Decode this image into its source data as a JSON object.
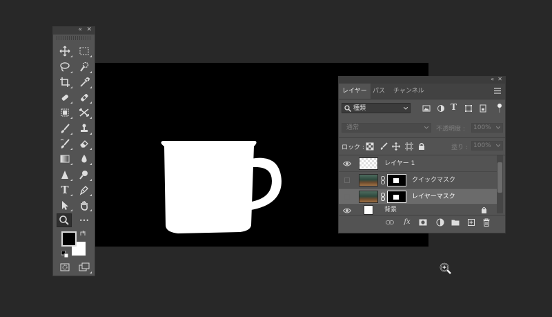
{
  "tools_panel": {
    "collapse_glyph": "«",
    "close_glyph": "✕",
    "tools": [
      {
        "icon": "move-icon"
      },
      {
        "icon": "marquee-icon"
      },
      {
        "icon": "lasso-icon"
      },
      {
        "icon": "quick-select-icon"
      },
      {
        "icon": "crop-icon"
      },
      {
        "icon": "eyedropper-icon"
      },
      {
        "icon": "healing-brush-icon"
      },
      {
        "icon": "bandage-icon"
      },
      {
        "icon": "clone-stamp-icon"
      },
      {
        "icon": "content-aware-move-icon"
      },
      {
        "icon": "brush-icon"
      },
      {
        "icon": "stamp-icon"
      },
      {
        "icon": "history-brush-icon"
      },
      {
        "icon": "eraser-icon"
      },
      {
        "icon": "gradient-icon"
      },
      {
        "icon": "blur-icon"
      },
      {
        "icon": "sharpen-icon"
      },
      {
        "icon": "dodge-icon"
      },
      {
        "icon": "type-icon",
        "text": "T"
      },
      {
        "icon": "pen-icon"
      },
      {
        "icon": "path-select-icon"
      },
      {
        "icon": "hand-icon"
      },
      {
        "icon": "zoom-icon",
        "selected": true
      },
      {
        "icon": "more-icon",
        "text": "•••"
      }
    ],
    "foreground_color": "#000000",
    "background_color": "#ffffff"
  },
  "canvas": {
    "background": "#000000",
    "subject": "white mug silhouette"
  },
  "layers_panel": {
    "collapse_glyph": "«",
    "close_glyph": "✕",
    "tabs": [
      {
        "label": "レイヤー",
        "active": true
      },
      {
        "label": "パス",
        "active": false
      },
      {
        "label": "チャンネル",
        "active": false
      }
    ],
    "filter": {
      "label": "種類"
    },
    "blend_mode": {
      "value": "通常"
    },
    "opacity": {
      "label": "不透明度 :",
      "value": "100%"
    },
    "lock": {
      "label": "ロック :"
    },
    "fill": {
      "label": "塗り :",
      "value": "100%"
    },
    "layers": [
      {
        "name": "レイヤー 1",
        "visible": true,
        "thumb": "checker",
        "mask": false,
        "selected": false
      },
      {
        "name": "クイックマスク",
        "visible": false,
        "thumb": "photo",
        "mask": true,
        "selected": false
      },
      {
        "name": "レイヤーマスク",
        "visible": false,
        "thumb": "photo",
        "mask": true,
        "selected": true
      },
      {
        "name": "背景",
        "visible": true,
        "thumb": "white",
        "mask": false,
        "selected": false,
        "locked": true
      }
    ],
    "footer_icons": [
      "link-icon",
      "fx-icon",
      "add-mask-icon",
      "adjustment-icon",
      "folder-icon",
      "new-layer-icon",
      "trash-icon"
    ],
    "fx_text": "fx"
  }
}
